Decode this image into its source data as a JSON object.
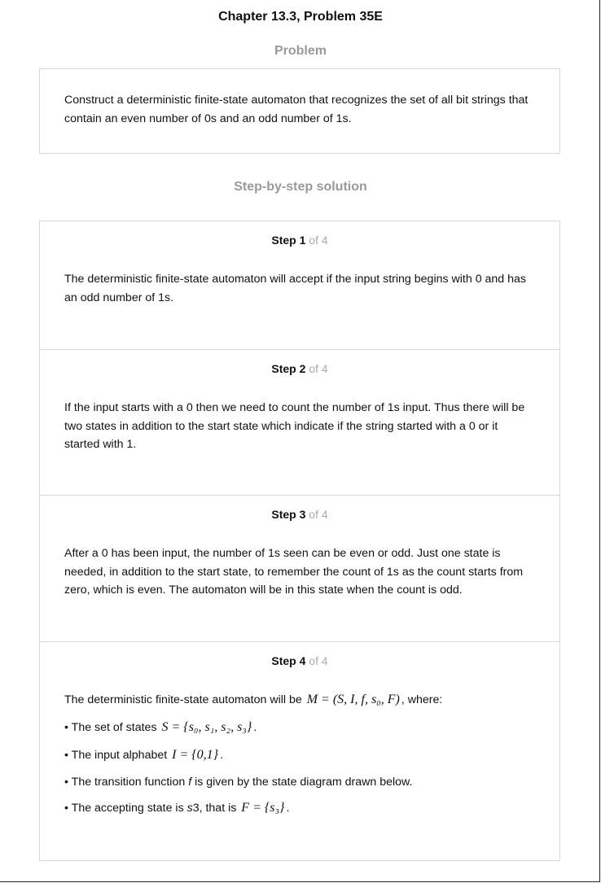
{
  "header": {
    "title": "Chapter 13.3, Problem 35E"
  },
  "problem": {
    "heading": "Problem",
    "text": "Construct a deterministic finite-state automaton that recognizes the set of all bit strings that contain an even number of 0s and an odd number of 1s."
  },
  "solution": {
    "heading": "Step-by-step solution",
    "steps": [
      {
        "label": "Step",
        "num": "1",
        "of": "of 4",
        "text": "The deterministic finite-state automaton will accept if the input string begins with 0 and has an odd number of 1s."
      },
      {
        "label": "Step",
        "num": "2",
        "of": "of 4",
        "text": "If the input starts with a 0 then we need to count the number of 1s input. Thus there will be two states in addition to the start state which indicate if the string started with a 0 or it started with 1."
      },
      {
        "label": "Step",
        "num": "3",
        "of": "of 4",
        "text": "After a 0 has been input, the number of 1s seen can be even or odd. Just one state is needed, in addition to the start state, to remember the count of 1s as the count starts from zero, which is even. The automaton will be in this state when the count is odd."
      },
      {
        "label": "Step",
        "num": "4",
        "of": "of 4",
        "intro": "The deterministic finite-state automaton will be",
        "intro_math": "M = (S, I, f, s₀, F)",
        "intro_end": ", where:",
        "bullets": [
          {
            "text": "• The set of states",
            "math": "S = {s₀, s₁, s₂, s₃}",
            "end": "."
          },
          {
            "text": "• The input alphabet",
            "math": "I = {0,1}",
            "end": "."
          },
          {
            "text": "• The transition function ",
            "italic": "f",
            "end": " is given by the state diagram drawn below."
          },
          {
            "text": "• The accepting state is ",
            "italic": "s",
            "mid": "3, that is",
            "math": "F = {s₃}",
            "end": "."
          }
        ]
      }
    ]
  }
}
